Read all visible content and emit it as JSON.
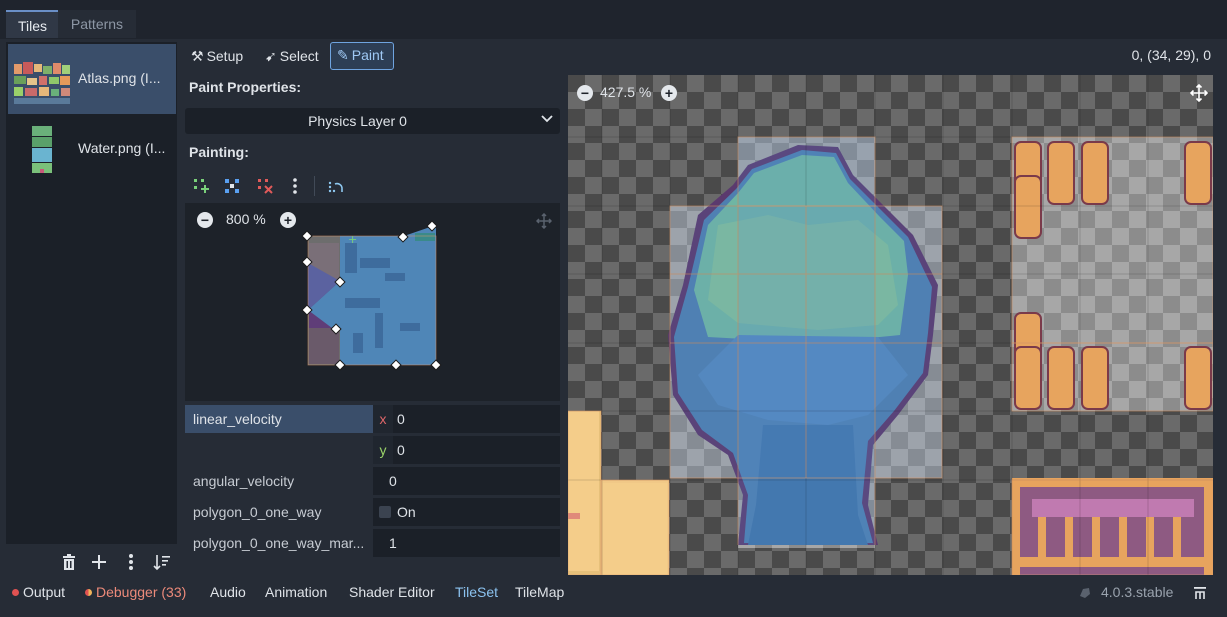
{
  "tabs": {
    "tiles": "Tiles",
    "patterns": "Patterns"
  },
  "sources": [
    {
      "label": "Atlas.png (I...",
      "selected": true
    },
    {
      "label": "Water.png (I...",
      "selected": false
    }
  ],
  "source_toolbar": {
    "icons": [
      "trash-icon",
      "plus-icon",
      "kebab-menu-icon",
      "sort-icon"
    ]
  },
  "toolbar": {
    "setup": "Setup",
    "select": "Select",
    "paint": "Paint",
    "coords": "0, (34, 29), 0"
  },
  "paint_properties": {
    "title": "Paint Properties:",
    "layer": "Physics Layer 0"
  },
  "painting": {
    "title": "Painting:"
  },
  "preview": {
    "zoom": "800 %"
  },
  "viewport": {
    "zoom": "427.5 %"
  },
  "properties": {
    "linear_velocity": {
      "name": "linear_velocity",
      "x_axis": "x",
      "x": "0",
      "y_axis": "y",
      "y": "0"
    },
    "angular_velocity": {
      "name": "angular_velocity",
      "value": "0"
    },
    "one_way": {
      "name": "polygon_0_one_way",
      "value": "On"
    },
    "one_way_margin": {
      "name": "polygon_0_one_way_mar...",
      "value": "1"
    }
  },
  "bottom": {
    "output": "Output",
    "debugger": "Debugger (33)",
    "audio": "Audio",
    "animation": "Animation",
    "shader": "Shader Editor",
    "tileset": "TileSet",
    "tilemap": "TileMap",
    "version": "4.0.3.stable"
  },
  "colors": {
    "accent": "#6fa4e0",
    "error": "#e05252",
    "warning": "#f0b45a",
    "debugger_text": "#ec8a7a",
    "tileset_text": "#8cc3f0"
  }
}
